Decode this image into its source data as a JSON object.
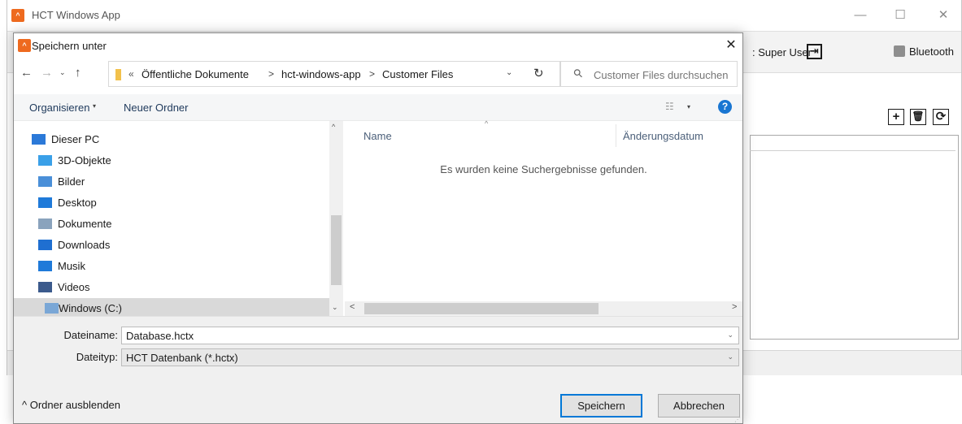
{
  "app": {
    "title": "HCT Windows App",
    "logo_text": "^",
    "window_controls": {
      "minimize": "—",
      "maximize": "☐",
      "close": "✕"
    },
    "user_label": ": Super User",
    "logout_icon": "⇥",
    "bluetooth_label": "Bluetooth",
    "toolbar_buttons": {
      "add": "+",
      "delete": "🗑",
      "refresh": "⟳"
    }
  },
  "dialog": {
    "title": "Speichern unter",
    "close": "✕",
    "nav": {
      "back": "←",
      "forward": "→",
      "recent": "⌄",
      "up": "↑"
    },
    "address": {
      "chevron": "«",
      "crumbs": [
        "Öffentliche Dokumente",
        "hct-windows-app",
        "Customer Files"
      ],
      "separator": ">",
      "dropdown": "⌄",
      "refresh": "↻"
    },
    "search": {
      "placeholder": "Customer Files durchsuchen",
      "icon": "⚲"
    },
    "commands": {
      "organize": "Organisieren",
      "organize_caret": "▾",
      "new_folder": "Neuer Ordner",
      "view_icon": "☷",
      "view_caret": "▾",
      "help": "?"
    },
    "tree": [
      {
        "label": "Dieser PC",
        "icon": "pc-icon",
        "color": "#2b79d8"
      },
      {
        "label": "3D-Objekte",
        "icon": "cube-icon",
        "color": "#3aa0e8"
      },
      {
        "label": "Bilder",
        "icon": "pictures-icon",
        "color": "#4a8fd8"
      },
      {
        "label": "Desktop",
        "icon": "desktop-icon",
        "color": "#1f7ad9"
      },
      {
        "label": "Dokumente",
        "icon": "documents-icon",
        "color": "#8aa3bd"
      },
      {
        "label": "Downloads",
        "icon": "downloads-icon",
        "color": "#1f6fd1"
      },
      {
        "label": "Musik",
        "icon": "music-icon",
        "color": "#1f7ad9"
      },
      {
        "label": "Videos",
        "icon": "videos-icon",
        "color": "#3b5a8c"
      },
      {
        "label": "Windows (C:)",
        "icon": "drive-icon",
        "color": "#7aa7d6",
        "selected": true
      }
    ],
    "columns": {
      "sort_indicator": "^",
      "name": "Name",
      "date": "Änderungsdatum"
    },
    "empty_message": "Es wurden keine Suchergebnisse gefunden.",
    "scroll": {
      "up": "^",
      "down": "⌄",
      "left": "<",
      "right": ">"
    },
    "form": {
      "filename_label": "Dateiname:",
      "filename_value": "Database.hctx",
      "filetype_label": "Dateityp:",
      "filetype_value": "HCT Datenbank (*.hctx)",
      "dropdown_caret": "⌄"
    },
    "hide_folders": "^  Ordner ausblenden",
    "buttons": {
      "save": "Speichern",
      "cancel": "Abbrechen"
    }
  },
  "colors": {
    "accent": "#0078d7",
    "logo": "#ee6a1f",
    "help": "#1976d2"
  }
}
